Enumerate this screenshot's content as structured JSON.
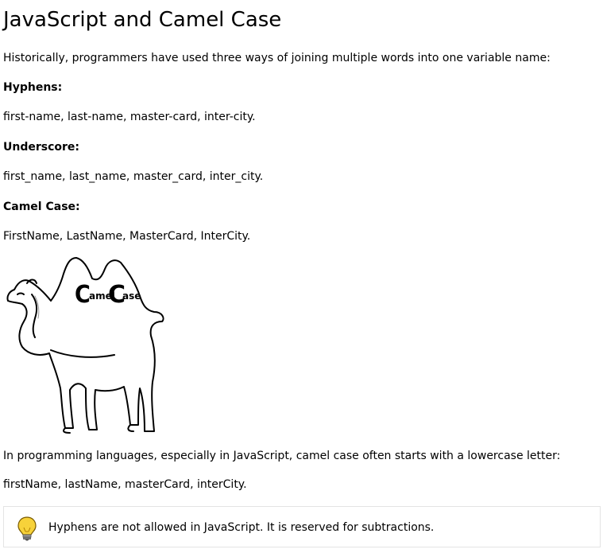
{
  "title": "JavaScript and Camel Case",
  "intro": "Historically, programmers have used three ways of joining multiple words into one variable name:",
  "sections": [
    {
      "heading": "Hyphens:",
      "example": "first-name, last-name, master-card, inter-city."
    },
    {
      "heading": "Underscore:",
      "example": "first_name, last_name, master_card, inter_city."
    },
    {
      "heading": "Camel Case:",
      "example": "FirstName, LastName, MasterCard, InterCity."
    }
  ],
  "camel_image": {
    "icon": "camel-illustration",
    "text": "CamelCase"
  },
  "js_paragraph": "In programming languages, especially in JavaScript, camel case often starts with a lowercase letter:",
  "js_example": "firstName, lastName, masterCard, interCity.",
  "note": {
    "icon": "lightbulb-icon",
    "text": "Hyphens are not allowed in JavaScript. It is reserved for subtractions."
  }
}
